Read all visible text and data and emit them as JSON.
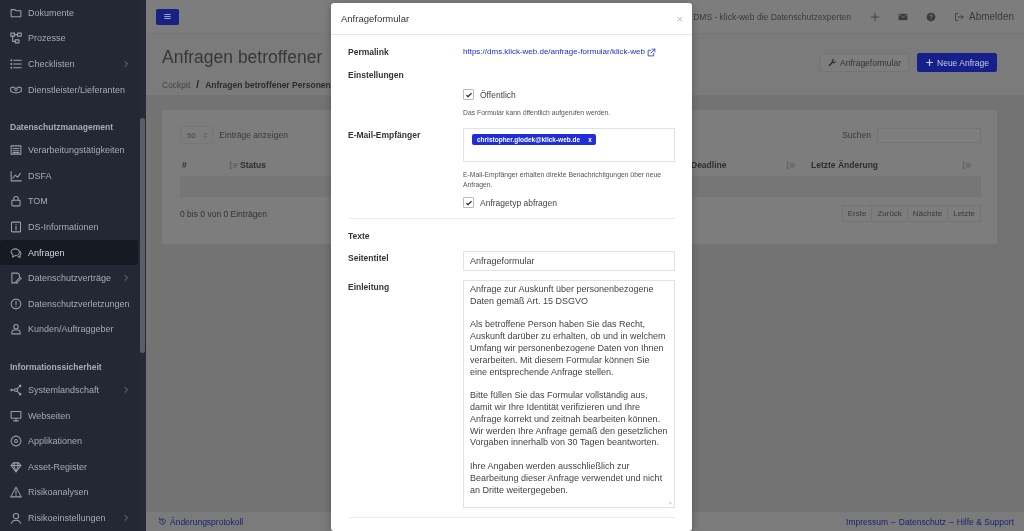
{
  "sidebar": {
    "sections": [
      {
        "items": [
          {
            "label": "Dokumente",
            "expandable": false,
            "selected": false
          },
          {
            "label": "Prozesse",
            "expandable": false,
            "selected": false
          },
          {
            "label": "Checklisten",
            "expandable": true,
            "selected": false
          },
          {
            "label": "Dienstleister/Lieferanten",
            "expandable": false,
            "selected": false
          }
        ]
      },
      {
        "heading": "Datenschutzmanagement",
        "items": [
          {
            "label": "Verarbeitungstätigkeiten",
            "expandable": false,
            "selected": false
          },
          {
            "label": "DSFA",
            "expandable": false,
            "selected": false
          },
          {
            "label": "TOM",
            "expandable": false,
            "selected": false
          },
          {
            "label": "DS-Informationen",
            "expandable": false,
            "selected": false
          },
          {
            "label": "Anfragen",
            "expandable": false,
            "selected": true
          },
          {
            "label": "Datenschutzverträge",
            "expandable": true,
            "selected": false
          },
          {
            "label": "Datenschutzverletzungen",
            "expandable": false,
            "selected": false
          },
          {
            "label": "Kunden/Auftraggeber",
            "expandable": false,
            "selected": false
          }
        ]
      },
      {
        "heading": "Informationssicherheit",
        "items": [
          {
            "label": "Systemlandschaft",
            "expandable": true,
            "selected": false
          },
          {
            "label": "Webseiten",
            "expandable": false,
            "selected": false
          },
          {
            "label": "Applikationen",
            "expandable": false,
            "selected": false
          },
          {
            "label": "Asset-Register",
            "expandable": false,
            "selected": false
          },
          {
            "label": "Risikoanalysen",
            "expandable": false,
            "selected": false
          },
          {
            "label": "Risikoeinstellungen",
            "expandable": true,
            "selected": false
          }
        ]
      }
    ]
  },
  "header": {
    "brand": "DMS - klick-web die Datenschutzexperten",
    "logout": "Abmelden"
  },
  "page": {
    "title": "Anfragen betroffener",
    "breadcrumb": [
      "Cockpit",
      "Anfragen betroffener Personen"
    ],
    "breadcrumb_separator": "/",
    "buttons": [
      {
        "label": "Anfrageformular",
        "kind": "secondary"
      },
      {
        "label": "Neue Anfrage",
        "kind": "primary"
      }
    ]
  },
  "table_panel": {
    "page_length": "50",
    "page_length_label": "Einträge anzeigen",
    "search_label": "Suchen",
    "columns": [
      "#",
      "Status",
      "Deadline",
      "Letzte Änderung"
    ],
    "info": "0 bis 0 von 0 Einträgen",
    "pagination": [
      "Erste",
      "Zurück",
      "Nächste",
      "Letzte"
    ]
  },
  "footer": {
    "changelog": "Änderungsprotokoll",
    "links": [
      "Impressum",
      "Datenschutz",
      "Hilfe & Support"
    ],
    "separator": "–"
  },
  "modal": {
    "title": "Anfrageformular",
    "close": "×",
    "permalink_label": "Permalink",
    "permalink": "https://dms.klick-web.de/anfrage-formular/klick-web",
    "settings_label": "Einstellungen",
    "public": {
      "label": "Öffentlich",
      "checked": true,
      "help": "Das Formular kann öffentlich aufgerufen werden."
    },
    "recipients_label": "E-Mail-Empfänger",
    "recipients": [
      {
        "email": "christopher.glodek@klick-web.de",
        "remove": "x"
      }
    ],
    "recipients_help": "E-Mail-Empfänger erhalten direkte Benachrichtigungen über neue Anfragen.",
    "ask_type": {
      "label": "Anfragetyp abfragen",
      "checked": true
    },
    "texts_label": "Texte",
    "page_title_label": "Seitentitel",
    "page_title": "Anfrageformular",
    "intro_label": "Einleitung",
    "intro": "Anfrage zur Auskunft über personenbezogene Daten gemäß Art. 15 DSGVO\n\nAls betroffene Person haben Sie das Recht, Auskunft darüber zu erhalten, ob und in welchem Umfang wir personenbezogene Daten von Ihnen verarbeiten. Mit diesem Formular können Sie eine entsprechende Anfrage stellen.\n\nBitte füllen Sie das Formular vollständig aus, damit wir Ihre Identität verifizieren und Ihre Anfrage korrekt und zeitnah bearbeiten können. Wir werden Ihre Anfrage gemäß den gesetzlichen Vorgaben innerhalb von 30 Tagen beantworten.\n\nIhre Angaben werden ausschließlich zur Bearbeitung dieser Anfrage verwendet und nicht an Dritte weitergegeben."
  }
}
